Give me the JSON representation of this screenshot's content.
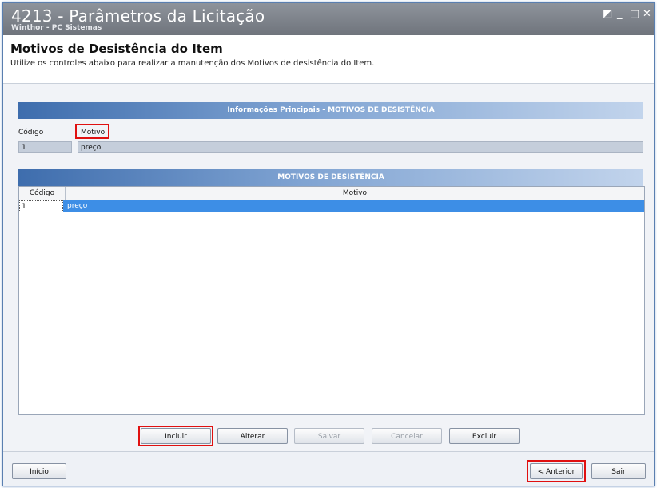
{
  "window": {
    "title": "4213 - Parâmetros da Licitação",
    "subtitle": "Winthor - PC Sistemas",
    "controls": {
      "restore": "◩",
      "minimize": "_",
      "maximize": "□",
      "close": "✕"
    }
  },
  "header": {
    "title": "Motivos de Desistência do Item",
    "description": "Utilize os controles abaixo para realizar a manutenção dos Motivos de desistência do Item."
  },
  "info_section": {
    "title": "Informações Principais - MOTIVOS DE DESISTÊNCIA",
    "codigo_label": "Código",
    "motivo_label": "Motivo",
    "codigo_value": "1",
    "motivo_value": "preço"
  },
  "grid_section": {
    "title": "MOTIVOS DE DESISTÊNCIA",
    "columns": [
      "Código",
      "Motivo"
    ],
    "rows": [
      {
        "codigo": "1",
        "motivo": "preço"
      }
    ]
  },
  "actions": {
    "incluir": "Incluir",
    "alterar": "Alterar",
    "salvar": "Salvar",
    "cancelar": "Cancelar",
    "excluir": "Excluir"
  },
  "footer": {
    "inicio": "Início",
    "anterior": "< Anterior",
    "sair": "Sair"
  },
  "colors": {
    "highlight": "#e01010",
    "selection": "#3d8ee6",
    "banner": "#3e6dad"
  }
}
